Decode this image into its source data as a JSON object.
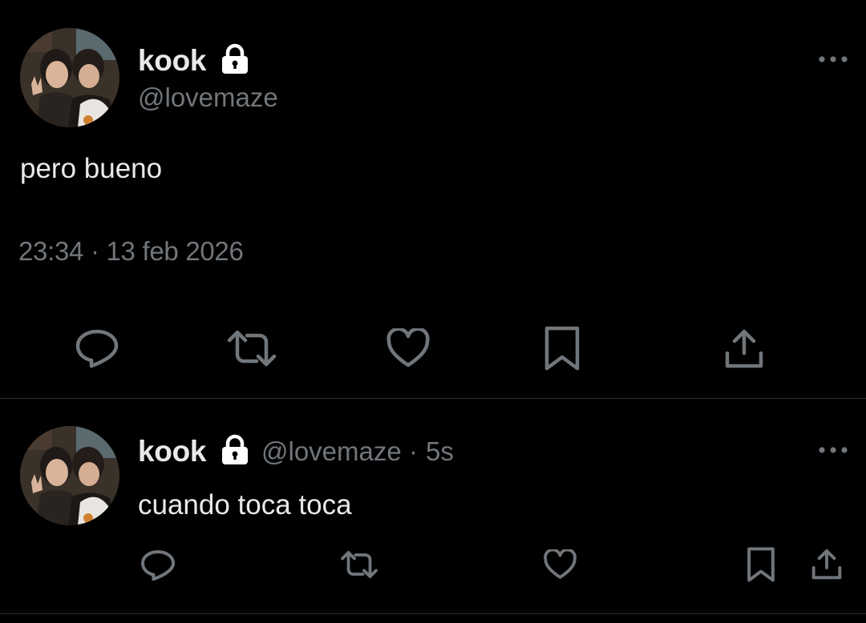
{
  "colors": {
    "background": "#000000",
    "text_primary": "#e7e9ea",
    "text_secondary": "#71767b",
    "divider": "#2f3336"
  },
  "main_tweet": {
    "author_name": "kook",
    "author_handle": "@lovemaze",
    "protected_icon": "lock-icon",
    "text": "pero bueno",
    "timestamp": "23:34 · 13 feb 2026",
    "actions": [
      "reply-icon",
      "retweet-icon",
      "like-icon",
      "bookmark-icon",
      "share-icon"
    ]
  },
  "reply_tweet": {
    "author_name": "kook",
    "author_handle": "@lovemaze",
    "separator": "·",
    "time_ago": "5s",
    "protected_icon": "lock-icon",
    "text": "cuando toca toca",
    "actions": [
      "reply-icon",
      "retweet-icon",
      "like-icon",
      "bookmark-icon",
      "share-icon"
    ]
  }
}
